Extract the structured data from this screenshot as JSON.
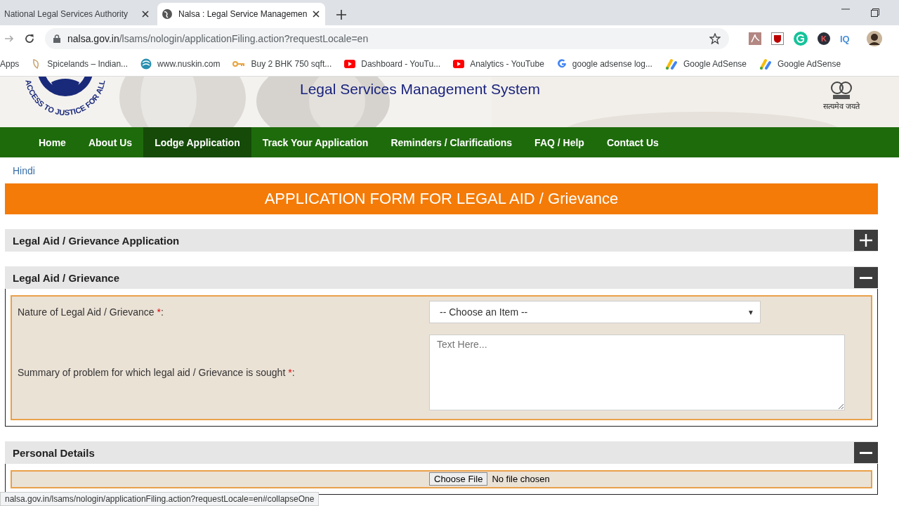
{
  "browser": {
    "tabs": [
      {
        "title": "National Legal Services Authority",
        "selected": false
      },
      {
        "title": "Nalsa : Legal Service Managemen",
        "selected": true
      }
    ],
    "address": {
      "domain": "nalsa.gov.in",
      "path": "/lsams/nologin/applicationFiling.action?requestLocale=en"
    },
    "bookmarks": [
      {
        "label": "Apps",
        "kind": "apps"
      },
      {
        "label": "Spicelands – Indian...",
        "kind": "leaf"
      },
      {
        "label": "www.nuskin.com",
        "kind": "globe"
      },
      {
        "label": "Buy 2 BHK 750 sqft...",
        "kind": "key"
      },
      {
        "label": "Dashboard - YouTu...",
        "kind": "youtube"
      },
      {
        "label": "Analytics - YouTube",
        "kind": "youtube"
      },
      {
        "label": "google adsense log...",
        "kind": "google"
      },
      {
        "label": "Google AdSense",
        "kind": "adsense"
      },
      {
        "label": "Google AdSense",
        "kind": "adsense"
      }
    ],
    "extensions": [
      {
        "label": "K",
        "kind": "circle",
        "color": "#2b2f3a"
      },
      {
        "label": "IQ",
        "kind": "text",
        "color": "#4a90d9"
      }
    ],
    "status_url": "nalsa.gov.in/lsams/nologin/applicationFiling.action?requestLocale=en#collapseOne"
  },
  "header": {
    "title": "Legal Services Management System",
    "logo_motto": "ACCESS TO JUSTICE FOR ALL",
    "emblem_motto": "सत्यमेव जयते"
  },
  "nav": [
    {
      "label": "Home",
      "selected": false
    },
    {
      "label": "About Us",
      "selected": false
    },
    {
      "label": "Lodge Application",
      "selected": true
    },
    {
      "label": "Track Your Application",
      "selected": false
    },
    {
      "label": "Reminders / Clarifications",
      "selected": false
    },
    {
      "label": "FAQ / Help",
      "selected": false
    },
    {
      "label": "Contact Us",
      "selected": false
    }
  ],
  "language_link": "Hindi",
  "form_title": "APPLICATION FORM FOR LEGAL AID / Grievance",
  "sections": [
    {
      "title": "Legal Aid / Grievance Application",
      "expanded": false
    },
    {
      "title": "Legal Aid / Grievance",
      "expanded": true,
      "fields": [
        {
          "kind": "select",
          "label": "Nature of Legal Aid / Grievance ",
          "required": "*",
          "suffix": ":",
          "value": "-- Choose an Item --",
          "caret": "▼"
        },
        {
          "kind": "textarea",
          "label": "Summary of problem for which legal aid / Grievance is sought ",
          "required": "*",
          "suffix": ":",
          "placeholder": "Text Here..."
        }
      ]
    },
    {
      "title": "Personal Details",
      "expanded": true,
      "fields": [
        {
          "kind": "file",
          "button": "Choose File",
          "value": "No file chosen"
        }
      ]
    }
  ]
}
